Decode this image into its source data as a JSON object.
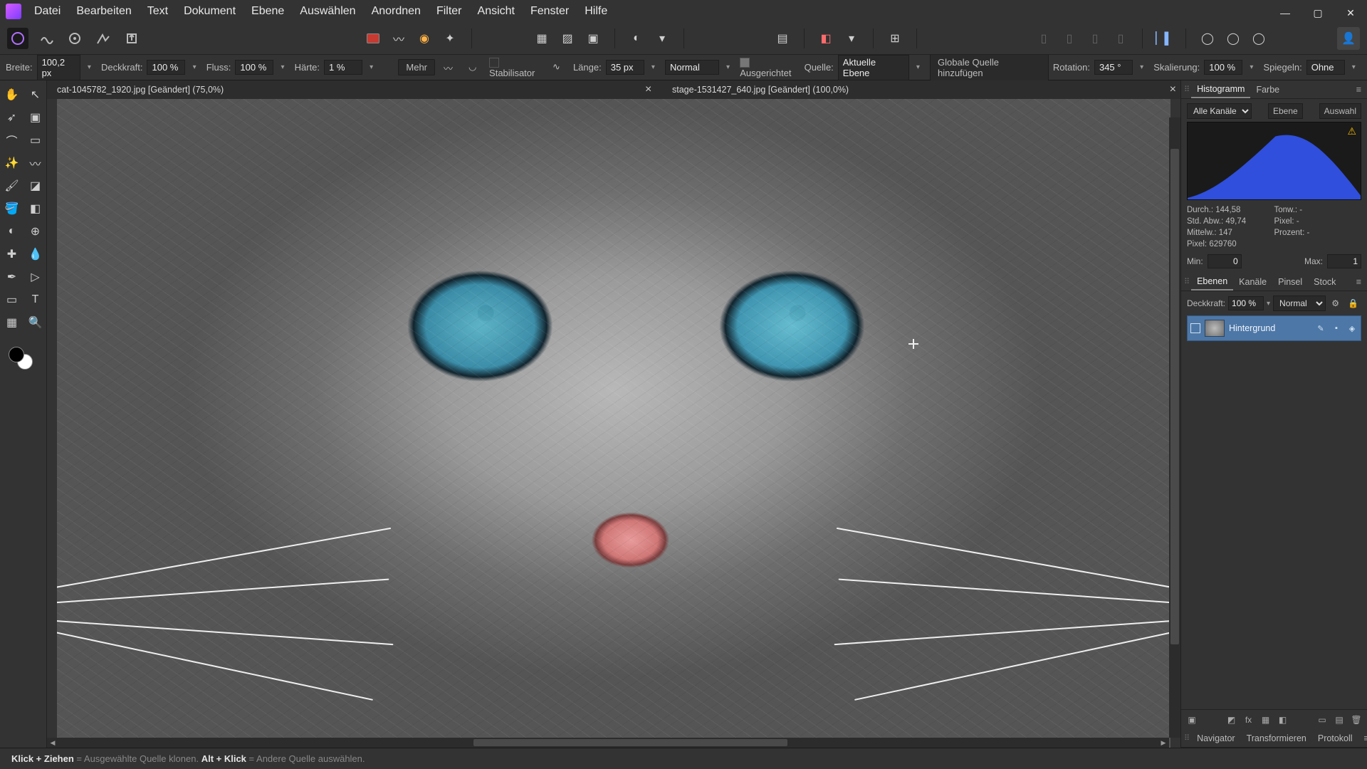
{
  "menu": [
    "Datei",
    "Bearbeiten",
    "Text",
    "Dokument",
    "Ebene",
    "Auswählen",
    "Anordnen",
    "Filter",
    "Ansicht",
    "Fenster",
    "Hilfe"
  ],
  "optbar": {
    "breite_lbl": "Breite:",
    "breite_val": "100,2 px",
    "deck_lbl": "Deckkraft:",
    "deck_val": "100 %",
    "fluss_lbl": "Fluss:",
    "fluss_val": "100 %",
    "haerte_lbl": "Härte:",
    "haerte_val": "1 %",
    "mehr": "Mehr",
    "stab": "Stabilisator",
    "laenge_lbl": "Länge:",
    "laenge_val": "35 px",
    "blend": "Normal",
    "ausger": "Ausgerichtet",
    "quelle_lbl": "Quelle:",
    "quelle_val": "Aktuelle Ebene",
    "globale": "Globale Quelle hinzufügen",
    "rot_lbl": "Rotation:",
    "rot_val": "345 °",
    "skal_lbl": "Skalierung:",
    "skal_val": "100 %",
    "spiegel_lbl": "Spiegeln:",
    "spiegel_val": "Ohne"
  },
  "tabs": [
    {
      "title": "cat-1045782_1920.jpg [Geändert] (75,0%)"
    },
    {
      "title": "stage-1531427_640.jpg [Geändert] (100,0%)"
    }
  ],
  "right_tabs_top": [
    "Histogramm",
    "Farbe"
  ],
  "histo": {
    "channel": "Alle Kanäle",
    "ebene_btn": "Ebene",
    "auswahl_btn": "Auswahl",
    "durch": "Durch.: 144,58",
    "stdabw": "Std. Abw.: 49,74",
    "mittel": "Mittelw.: 147",
    "pixel": "Pixel: 629760",
    "tonw": "Tonw.: -",
    "pix": "Pixel: -",
    "proz": "Prozent: -",
    "min_lbl": "Min:",
    "min": "0",
    "max_lbl": "Max:",
    "max": "1"
  },
  "right_tabs_mid": [
    "Ebenen",
    "Kanäle",
    "Pinsel",
    "Stock"
  ],
  "layer": {
    "deck_lbl": "Deckkraft:",
    "deck_val": "100 %",
    "blend": "Normal",
    "name": "Hintergrund"
  },
  "right_tabs_bot": [
    "Navigator",
    "Transformieren",
    "Protokoll"
  ],
  "status": {
    "s1a": "Klick + Ziehen",
    "s1b": " = Ausgewählte Quelle klonen. ",
    "s2a": "Alt + Klick",
    "s2b": " = Andere Quelle auswählen."
  },
  "toolbar1_colors": {
    "swatch": "#c63a32"
  }
}
